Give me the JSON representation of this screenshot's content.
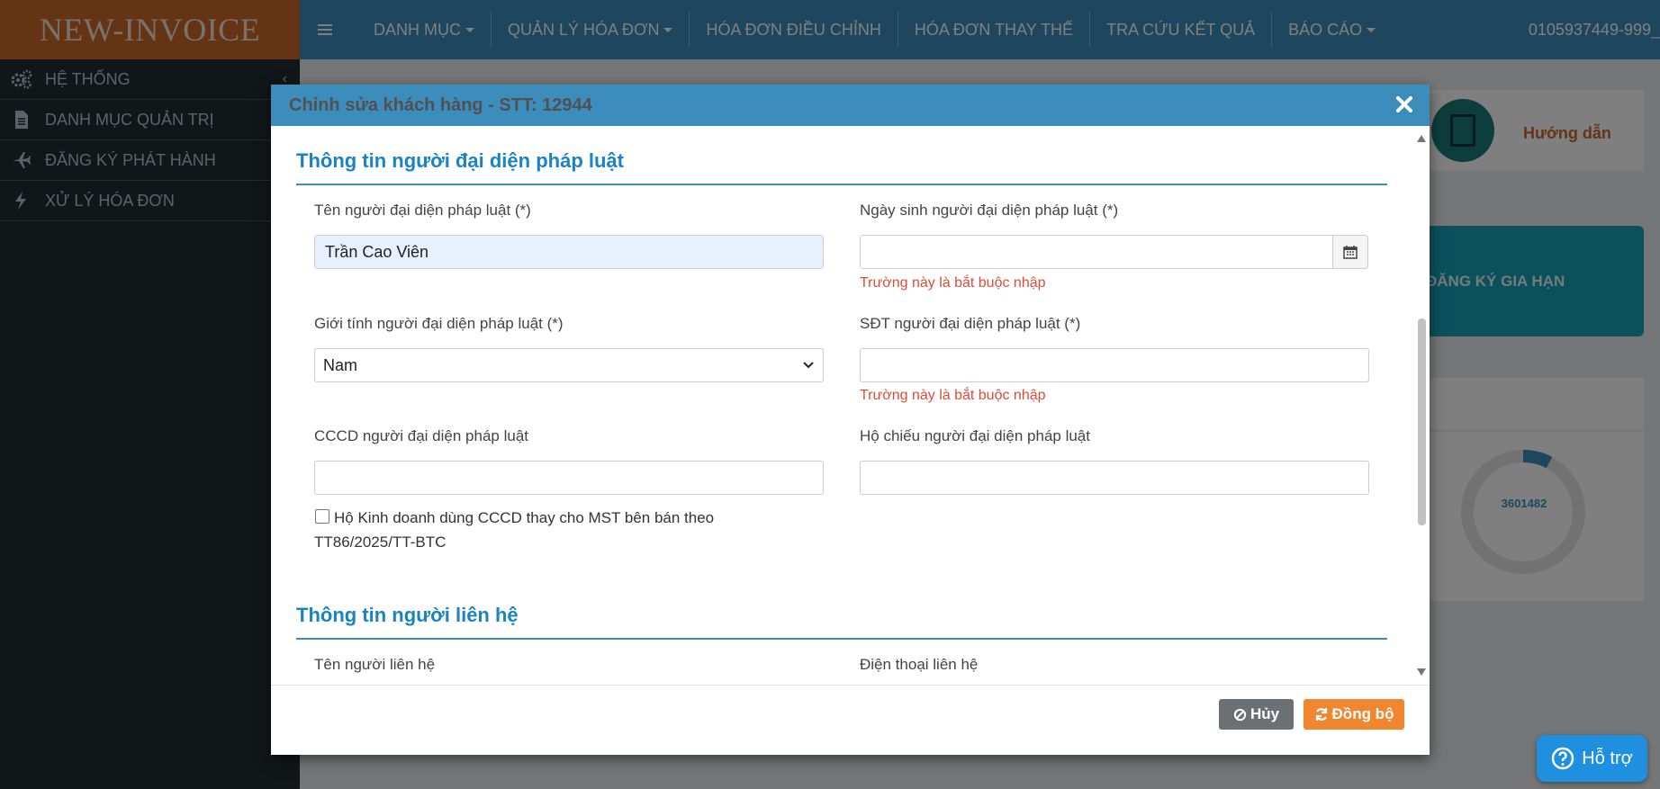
{
  "app": {
    "logo": "NEW-INVOICE"
  },
  "topnav": {
    "items": [
      {
        "label": "DANH MỤC",
        "dropdown": true
      },
      {
        "label": "QUẢN LÝ HÓA ĐƠN",
        "dropdown": true
      },
      {
        "label": "HÓA ĐƠN ĐIỀU CHỈNH",
        "dropdown": false
      },
      {
        "label": "HÓA ĐƠN THAY THẾ",
        "dropdown": false
      },
      {
        "label": "TRA CỨU KẾT QUẢ",
        "dropdown": false
      },
      {
        "label": "BÁO CÁO",
        "dropdown": true
      }
    ],
    "user": "0105937449-999_"
  },
  "sidebar": {
    "items": [
      {
        "label": "HỆ THỐNG",
        "icon": "gears-icon"
      },
      {
        "label": "DANH MỤC QUẢN TRỊ",
        "icon": "document-icon"
      },
      {
        "label": "ĐĂNG KÝ PHÁT HÀNH",
        "icon": "plane-icon"
      },
      {
        "label": "XỬ LÝ HÓA ĐƠN",
        "icon": "bolt-icon"
      }
    ]
  },
  "background": {
    "guide_label": "Hướng dẫn",
    "renew_label": "ĐĂNG KÝ GIA HẠN",
    "donut_value": "3601482"
  },
  "modal": {
    "title": "Chỉnh sửa khách hàng - STT: 12944",
    "section_legal": "Thông tin người đại diện pháp luật",
    "fields": {
      "rep_name_label": "Tên người đại diện pháp luật (*)",
      "rep_name_value": "Trần Cao Viên",
      "rep_dob_label": "Ngày sinh người đại diện pháp luật (*)",
      "rep_dob_value": "",
      "rep_gender_label": "Giới tính người đại diện pháp luật (*)",
      "rep_gender_value": "Nam",
      "rep_phone_label": "SĐT người đại diện pháp luật (*)",
      "rep_phone_value": "",
      "rep_cccd_label": "CCCD người đại diện pháp luật",
      "rep_cccd_value": "",
      "rep_passport_label": "Hộ chiếu người đại diện pháp luật",
      "rep_passport_value": ""
    },
    "required_error": "Trường này là bắt buộc nhập",
    "checkbox_line1": "Hộ Kinh doanh dùng CCCD thay cho MST bên bán theo",
    "checkbox_line2": "TT86/2025/TT-BTC",
    "section_contact": "Thông tin người liên hệ",
    "contact_name_label": "Tên người liên hệ",
    "contact_phone_label": "Điện thoại liên hệ",
    "cancel_label": "Hủy",
    "sync_label": "Đồng bộ"
  },
  "support": {
    "label": "Hỗ trợ"
  },
  "colors": {
    "primary": "#3c8dbc",
    "logo": "#c8692a",
    "sidebar": "#222d32",
    "error": "#dd4b39",
    "sync": "#f0862f",
    "cancel": "#6b7075"
  }
}
